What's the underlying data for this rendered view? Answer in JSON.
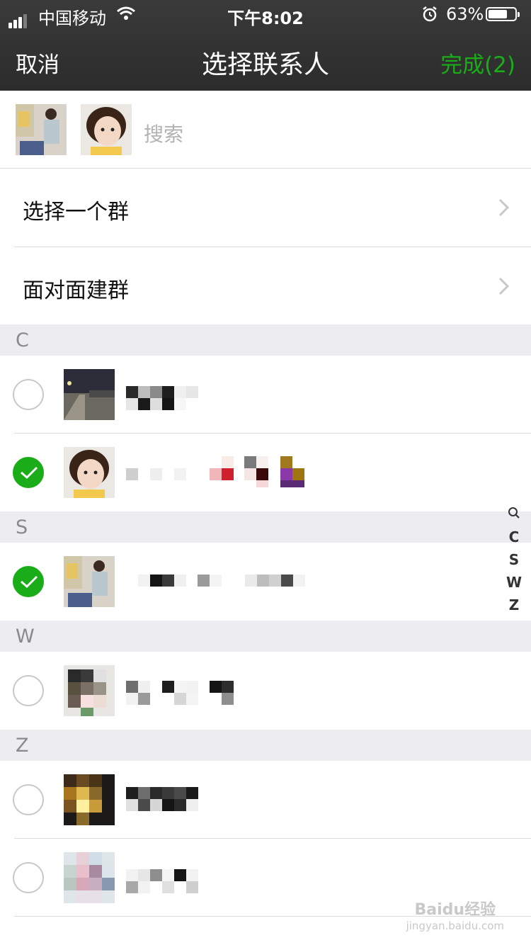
{
  "status_bar": {
    "carrier": "中国移动",
    "time": "下午8:02",
    "battery_percent": "63%",
    "signal_bars": 3,
    "battery_level": 0.63
  },
  "nav": {
    "cancel": "取消",
    "title": "选择联系人",
    "done": "完成(2)",
    "done_color": "#1aad19"
  },
  "search": {
    "placeholder": "搜索"
  },
  "menu": [
    {
      "label": "选择一个群"
    },
    {
      "label": "面对面建群"
    }
  ],
  "sections": [
    "C",
    "S",
    "W",
    "Z"
  ],
  "contacts": [
    {
      "section": "C",
      "checked": false,
      "name": "",
      "icon": "blurred-name"
    },
    {
      "section": "C",
      "checked": true,
      "name": "",
      "icon": "blurred-name"
    },
    {
      "section": "S",
      "checked": true,
      "name": "",
      "icon": "blurred-name"
    },
    {
      "section": "W",
      "checked": false,
      "name": "",
      "icon": "blurred-name"
    },
    {
      "section": "Z",
      "checked": false,
      "name": "",
      "icon": "blurred-name"
    },
    {
      "section": "Z",
      "checked": false,
      "name": "",
      "icon": "blurred-name"
    }
  ],
  "index_bar": [
    "C",
    "S",
    "W",
    "Z"
  ],
  "watermark": {
    "main": "Baidu经验",
    "sub": "jingyan.baidu.com"
  },
  "colors": {
    "accent": "#1aad19",
    "nav_bg": "#2e2e2e",
    "section_bg": "#ededf1"
  }
}
